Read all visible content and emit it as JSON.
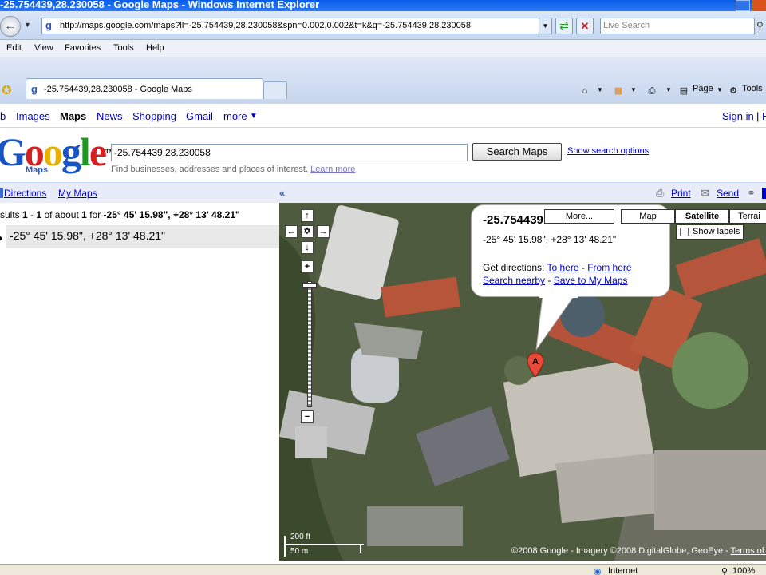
{
  "window": {
    "title": "-25.754439,28.230058 - Google Maps - Windows Internet Explorer"
  },
  "addressbar": {
    "url": "http://maps.google.com/maps?ll=-25.754439,28.230058&spn=0.002,0.002&t=k&q=-25.754439,28.230058",
    "live_search_placeholder": "Live Search"
  },
  "menu": [
    "Edit",
    "View",
    "Favorites",
    "Tools",
    "Help"
  ],
  "tab": {
    "title": "-25.754439,28.230058 - Google Maps"
  },
  "commandbar": {
    "page": "Page",
    "tools": "Tools"
  },
  "google_links": {
    "items": [
      "b",
      "Images",
      "Maps",
      "News",
      "Shopping",
      "Gmail",
      "more"
    ],
    "active": "Maps",
    "more_arrow": "▼",
    "sign_in": "Sign in",
    "separator": "|",
    "cut": "H"
  },
  "logo": {
    "text": "Google",
    "sub": "Maps",
    "tm": "TM"
  },
  "search": {
    "value": "-25.754439,28.230058",
    "button": "Search Maps",
    "options_link": "Show search options",
    "hint_prefix": "Find businesses, addresses and places of interest.",
    "hint_link": "Learn more"
  },
  "panel": {
    "directions": "Directions",
    "my_maps": "My Maps",
    "collapse_icon": "«",
    "print": "Print",
    "send": "Send"
  },
  "results": {
    "prefix": "sults",
    "start": "1",
    "dash": "-",
    "end": "1",
    "of_about": "of about",
    "total": "1",
    "for_word": "for",
    "query": "-25° 45' 15.98\", +28° 13' 48.21\"",
    "item": "-25° 45' 15.98\", +28° 13' 48.21\""
  },
  "map_types": {
    "more": "More...",
    "map": "Map",
    "satellite": "Satellite",
    "terrain": "Terrai",
    "show_labels": "Show labels",
    "active": "Satellite"
  },
  "info": {
    "title": "-25.754439",
    "dms": "-25° 45' 15.98\", +28° 13' 48.21\"",
    "get_directions": "Get directions:",
    "to_here": "To here",
    "dash": "-",
    "from_here": "From here",
    "search_nearby": "Search nearby",
    "save": "Save to My Maps"
  },
  "marker": {
    "label": "A"
  },
  "scale": {
    "ft": "200 ft",
    "m": "50 m"
  },
  "copyright": {
    "text": "©2008 Google - Imagery ©2008 DigitalGlobe, GeoEye -",
    "link": "Terms of U"
  },
  "status": {
    "zone": "Internet",
    "zoom": "100%"
  }
}
